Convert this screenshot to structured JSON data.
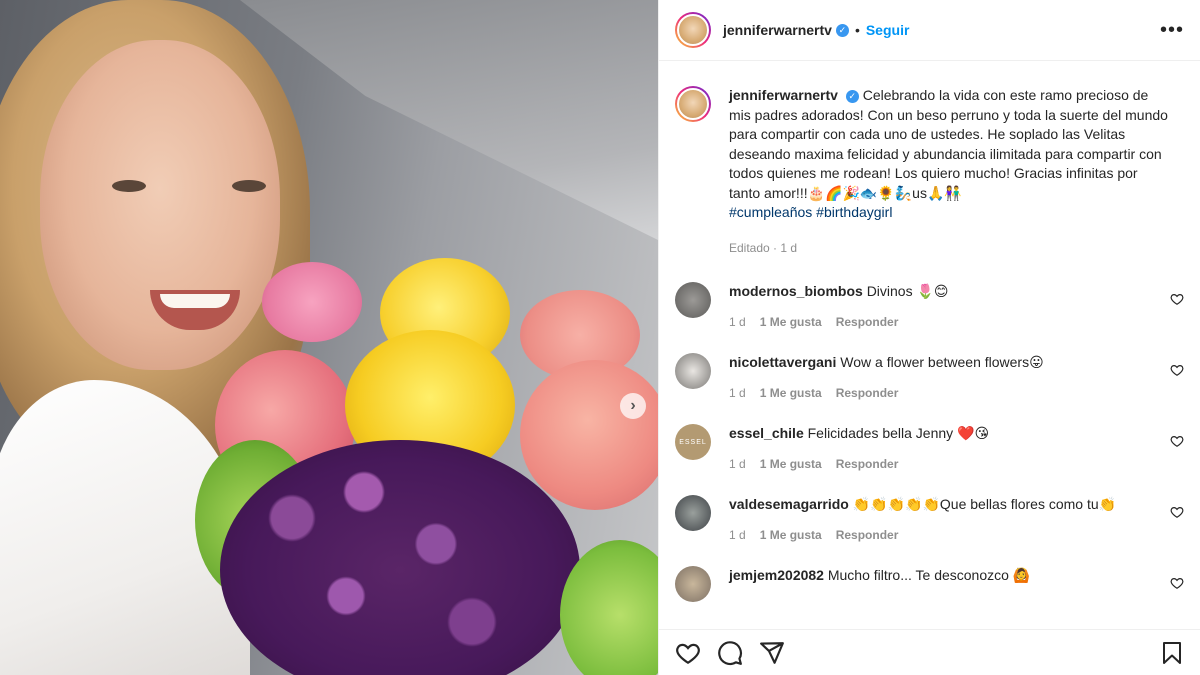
{
  "post": {
    "username": "jenniferwarnertv",
    "follow_label": "Seguir",
    "separator": "•",
    "more_label": "•••",
    "carousel_next": "›"
  },
  "caption": {
    "username": "jenniferwarnertv",
    "text": "Celebrando la vida con este ramo precioso de mis padres adorados! Con un beso perruno y toda la suerte del mundo para compartir con cada uno de ustedes. He soplado las Velitas deseando maxima felicidad y abundancia ilimitada para compartir con todos quienes me rodean! Los quiero mucho! Gracias infinitas por tanto amor!!!🎂🌈🎉🐟🌻🧞us🙏👫",
    "hashtags": [
      "#cumpleaños",
      "#birthdaygirl"
    ],
    "edited": "Editado · 1 d"
  },
  "comments": [
    {
      "username": "modernos_biombos",
      "text": "Divinos 🌷😊",
      "time": "1 d",
      "likes": "1 Me gusta",
      "reply": "Responder",
      "avatar_color": "#6b6a69"
    },
    {
      "username": "nicolettavergani",
      "text": "Wow a flower between flowers😛",
      "time": "1 d",
      "likes": "1 Me gusta",
      "reply": "Responder",
      "avatar_color": "#8b8b8b"
    },
    {
      "username": "essel_chile",
      "text": "Felicidades bella Jenny ❤️😘",
      "time": "1 d",
      "likes": "1 Me gusta",
      "reply": "Responder",
      "avatar_color": "#b39a72",
      "avatar_text": "ESSEL"
    },
    {
      "username": "valdesemagarrido",
      "text": "👏👏👏👏👏Que bellas flores como tu👏",
      "time": "1 d",
      "likes": "1 Me gusta",
      "reply": "Responder",
      "avatar_color": "#4d5156"
    },
    {
      "username": "jemjem202082",
      "text": "Mucho filtro... Te desconozco 🙆",
      "time": "",
      "likes": "",
      "reply": "",
      "avatar_color": "#a7a39d"
    }
  ],
  "icons": {
    "verified": "verified-badge-icon",
    "heart": "heart-icon",
    "comment": "comment-icon",
    "share": "paper-plane-icon",
    "save": "bookmark-icon"
  },
  "colors": {
    "link": "#0095f6",
    "hashtag": "#00376b",
    "muted": "#8e8e8e",
    "verified": "#3897f0"
  }
}
